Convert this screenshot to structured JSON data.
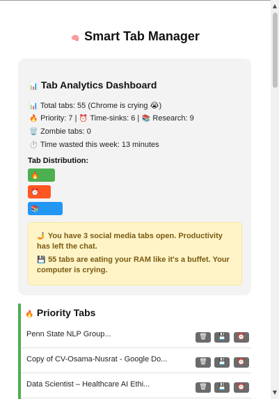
{
  "app": {
    "title": "Smart Tab Manager",
    "title_icon": "🧠"
  },
  "dashboard": {
    "title": "Tab Analytics Dashboard",
    "title_icon": "📊",
    "stats": {
      "total": {
        "icon": "📊",
        "text": "Total tabs: 55 (Chrome is crying 😭)"
      },
      "categories": {
        "priority_icon": "🔥",
        "priority": "Priority: 7 |",
        "timesink_icon": "⏰",
        "timesink": "Time-sinks: 6 |",
        "research_icon": "📚",
        "research": "Research: 9"
      },
      "zombie": {
        "icon": "🗑️",
        "text": "Zombie tabs: 0"
      },
      "wasted": {
        "icon": "⏱️",
        "text": "Time wasted this week: 13 minutes"
      }
    },
    "distribution": {
      "title": "Tab Distribution:",
      "bars": [
        {
          "icon": "🔥",
          "color": "#4caf50",
          "category": "priority",
          "value": 7
        },
        {
          "icon": "⏰",
          "color": "#ff5722",
          "category": "time-sinks",
          "value": 6
        },
        {
          "icon": "📚",
          "color": "#2196f3",
          "category": "research",
          "value": 9
        }
      ]
    },
    "warnings": {
      "social": {
        "icon": "🤳",
        "text": "You have 3 social media tabs open. Productivity has left the chat."
      },
      "ram": {
        "icon": "💾",
        "text": "55 tabs are eating your RAM like it's a buffet. Your computer is crying."
      }
    }
  },
  "priority": {
    "title": "Priority Tabs",
    "icon": "🔥",
    "tabs": [
      {
        "title": "Penn State NLP Group..."
      },
      {
        "title": "Copy of CV-Osama-Nusrat - Google Do..."
      },
      {
        "title": "Data Scientist – Healthcare AI Ethi..."
      }
    ],
    "actions": {
      "delete_icon": "🗑",
      "save_icon": "💾",
      "timer_icon": "⏰"
    }
  },
  "scrollbar": {
    "up_icon": "▲",
    "down_icon": "▼"
  }
}
